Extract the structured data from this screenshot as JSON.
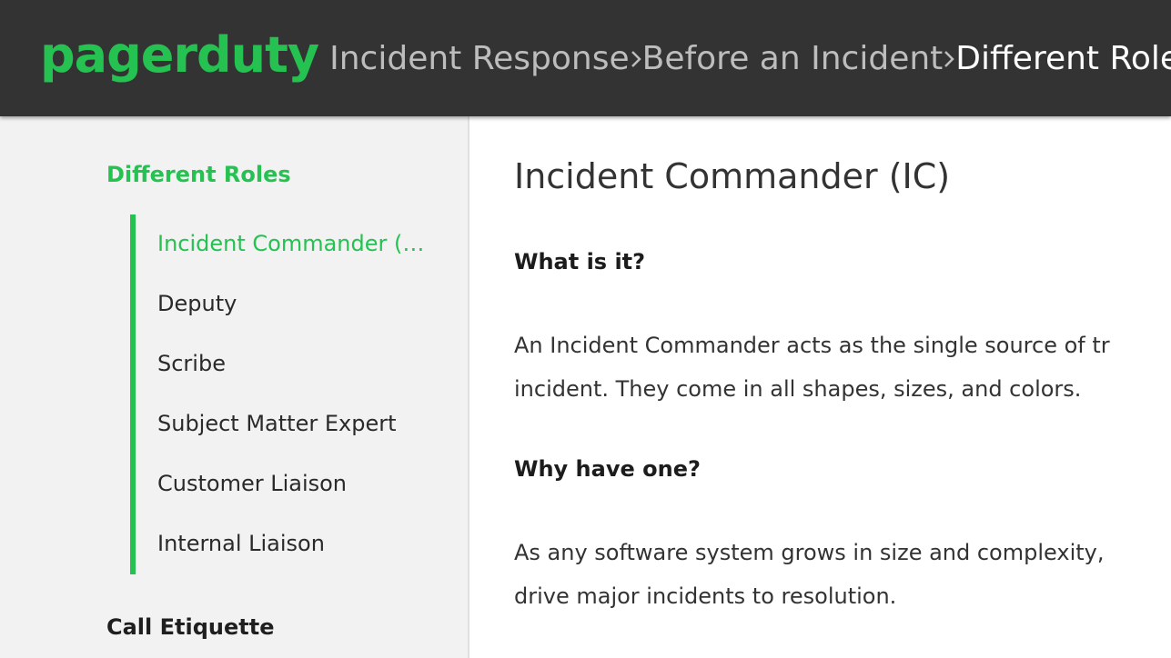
{
  "header": {
    "logo": "pagerduty",
    "breadcrumbs": [
      "Incident Response",
      "Before an Incident",
      "Different Roles"
    ],
    "background": "#333333",
    "accent": "#25c151"
  },
  "sidebar": {
    "section_active": "Different Roles",
    "items": [
      "Incident Commander (IC)",
      "Deputy",
      "Scribe",
      "Subject Matter Expert",
      "Customer Liaison",
      "Internal Liaison"
    ],
    "next_section": "Call Etiquette"
  },
  "content": {
    "title": "Incident Commander (IC)",
    "q1": "What is it?",
    "p1_line1": "An Incident Commander acts as the single source of tr",
    "p1_line2": "incident. They come in all shapes, sizes, and colors.",
    "q2": "Why have one?",
    "p2_line1": "As any software system grows in size and complexity,",
    "p2_line2": "drive major incidents to resolution."
  }
}
